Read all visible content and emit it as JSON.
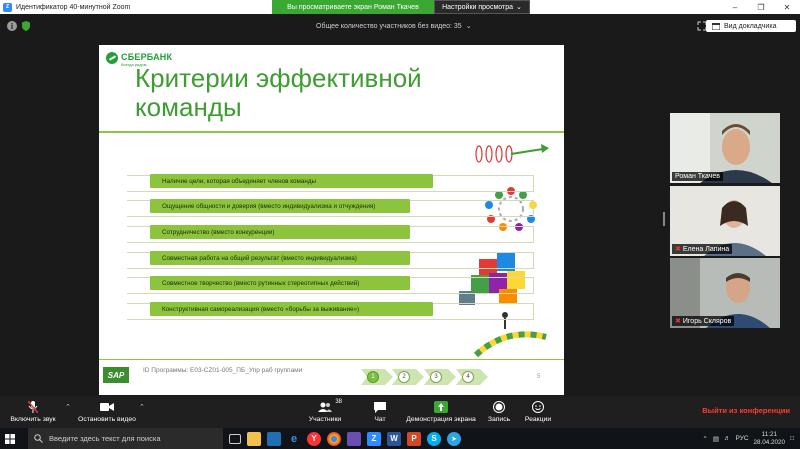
{
  "window": {
    "title": "Идентификатор 40-минутной Zoom"
  },
  "share_banner": {
    "viewing": "Вы просматриваете экран Роман Ткачев",
    "view_settings": "Настройки просмотра"
  },
  "topbar": {
    "no_video_count": "Общее количество участников без видео: 35",
    "view_mode": "Вид докладчика"
  },
  "slide": {
    "logo_text": "СБЕРБАНК",
    "logo_sub": "Всегда рядом",
    "title": "Критерии эффективной команды",
    "criteria": [
      "Наличие цели, которая объединяет членов команды",
      "Ощущение общности и доверия (вместо индивидуализма и отчуждения)",
      "Сотрудничество (вместо конкуренции)",
      "Совместная работа на общий результат (вместо индивидуализма)",
      "Совместное творчество (вместо рутинных стереотипных действий)",
      "Конструктивная самореализация (вместо «борьбы за выживание»)"
    ],
    "footer": {
      "sap": "SAP",
      "program_id": "ID Программы: E03-CZ01-005_ПБ_Упр раб группами",
      "steps": [
        "1",
        "2",
        "3",
        "4"
      ],
      "active_step": 1,
      "page": "5"
    }
  },
  "participants": [
    {
      "name": "Роман Ткачев",
      "muted": false
    },
    {
      "name": "Елена Лапина",
      "muted": true
    },
    {
      "name": "Игорь Скляров",
      "muted": true
    }
  ],
  "controls": {
    "unmute": "Включить звук",
    "start_video": "Остановить видео",
    "participants": "Участники",
    "participants_count": "38",
    "chat": "Чат",
    "share_screen": "Демонстрация экрана",
    "record": "Запись",
    "reactions": "Реакции",
    "leave": "Выйти из конференции"
  },
  "taskbar": {
    "search_placeholder": "Введите здесь текст для поиска",
    "language": "РУС",
    "time": "11:21",
    "date": "28.04.2020"
  },
  "colors": {
    "accent_green": "#8cc43e",
    "title_green": "#3e9d31",
    "zoom_blue": "#2d8cff",
    "leave_red": "#ff3b30"
  }
}
